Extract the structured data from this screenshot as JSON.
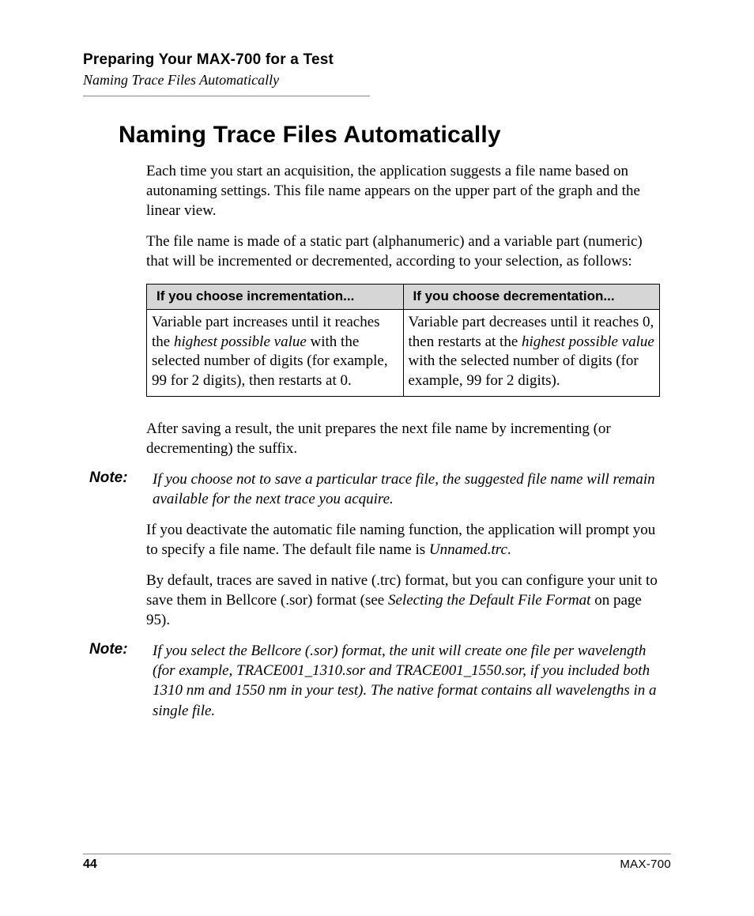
{
  "running": {
    "chapter": "Preparing Your MAX-700 for a Test",
    "section": "Naming Trace Files Automatically"
  },
  "title": "Naming Trace Files Automatically",
  "para": {
    "intro1": "Each time you start an acquisition, the application suggests a file name based on autonaming settings. This file name appears on the upper part of the graph and the linear view.",
    "intro2": "The file name is made of a static part (alphanumeric) and a variable part (numeric) that will be incremented or decremented, according to your selection, as follows:",
    "afterTable": "After saving a result, the unit prepares the next file name by incrementing (or decrementing) the suffix.",
    "deact_a": "If you deactivate the automatic file naming function, the application will prompt you to specify a file name. The default file name is ",
    "deact_file": "Unnamed.trc",
    "deact_b": ".",
    "fmt_a": "By default, traces are saved in native (.trc) format, but you can configure your unit to save them in Bellcore (.sor) format (see ",
    "fmt_ref": "Selecting the Default File Format",
    "fmt_b": " on page 95)."
  },
  "table": {
    "header_inc": "If you choose incrementation...",
    "header_dec": "If you choose decrementation...",
    "inc_a": "Variable part increases until it reaches the ",
    "inc_i": "highest possible value",
    "inc_b": " with the selected number of digits (for example, 99 for 2 digits), then restarts at 0.",
    "dec_a": "Variable part decreases until it reaches 0, then restarts at the ",
    "dec_i": "highest possible value",
    "dec_b": " with the selected number of digits (for example, 99 for 2 digits)."
  },
  "notes": {
    "label": "Note:",
    "n1": "If you choose not to save a particular trace file, the suggested file name will remain available for the next trace you acquire.",
    "n2": "If you select the Bellcore (.sor) format, the unit will create one file per wavelength (for example, TRACE001_1310.sor and TRACE001_1550.sor, if you included both 1310 nm and 1550 nm in your test). The native format contains all wavelengths in a single file."
  },
  "footer": {
    "page": "44",
    "product": "MAX-700"
  }
}
